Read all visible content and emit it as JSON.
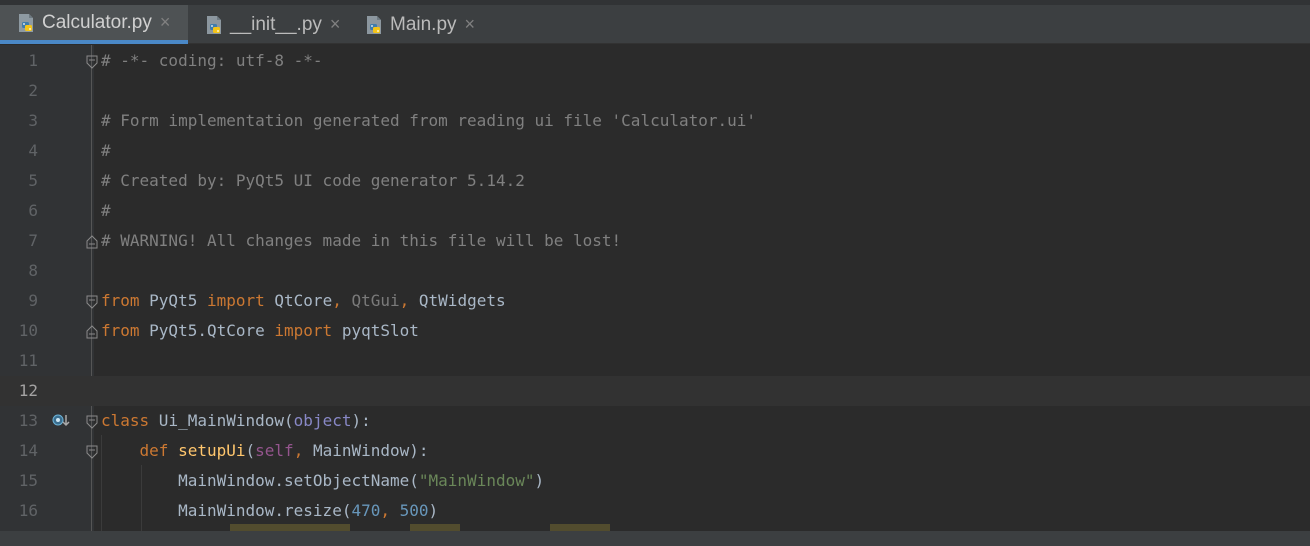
{
  "tabs": [
    {
      "label": "Calculator.py",
      "active": true
    },
    {
      "label": "__init__.py",
      "active": false
    },
    {
      "label": "Main.py",
      "active": false
    }
  ],
  "close_glyph": "×",
  "lines": [
    {
      "n": "1",
      "fold": "start",
      "tokens": [
        {
          "t": "# -*- coding: utf-8 -*-",
          "c": "comment"
        }
      ]
    },
    {
      "n": "2",
      "tokens": []
    },
    {
      "n": "3",
      "tokens": [
        {
          "t": "# Form implementation generated from reading ui file 'Calculator.ui'",
          "c": "comment"
        }
      ]
    },
    {
      "n": "4",
      "tokens": [
        {
          "t": "#",
          "c": "comment"
        }
      ]
    },
    {
      "n": "5",
      "tokens": [
        {
          "t": "# Created by: PyQt5 UI code generator 5.14.2",
          "c": "comment"
        }
      ]
    },
    {
      "n": "6",
      "tokens": [
        {
          "t": "#",
          "c": "comment"
        }
      ]
    },
    {
      "n": "7",
      "fold": "end",
      "tokens": [
        {
          "t": "# WARNING! All changes made in this file will be lost!",
          "c": "comment"
        }
      ]
    },
    {
      "n": "8",
      "tokens": []
    },
    {
      "n": "9",
      "fold": "start",
      "tokens": [
        {
          "t": "from",
          "c": "kw"
        },
        {
          "t": " PyQt5 ",
          "c": "plain"
        },
        {
          "t": "import",
          "c": "kw"
        },
        {
          "t": " QtCore",
          "c": "plain"
        },
        {
          "t": ", ",
          "c": "kw"
        },
        {
          "t": "QtGui",
          "c": "dim"
        },
        {
          "t": ", ",
          "c": "kw"
        },
        {
          "t": "QtWidgets",
          "c": "plain"
        }
      ]
    },
    {
      "n": "10",
      "fold": "end",
      "tokens": [
        {
          "t": "from",
          "c": "kw"
        },
        {
          "t": " PyQt5.QtCore ",
          "c": "plain"
        },
        {
          "t": "import",
          "c": "kw"
        },
        {
          "t": " pyqtSlot",
          "c": "plain"
        }
      ]
    },
    {
      "n": "11",
      "tokens": []
    },
    {
      "n": "12",
      "current": true,
      "tokens": []
    },
    {
      "n": "13",
      "fold": "start",
      "bookmark": true,
      "tokens": [
        {
          "t": "class",
          "c": "kw"
        },
        {
          "t": " Ui_MainWindow(",
          "c": "plain"
        },
        {
          "t": "object",
          "c": "builtin"
        },
        {
          "t": "):",
          "c": "plain"
        }
      ]
    },
    {
      "n": "14",
      "fold": "start",
      "tokens": [
        {
          "t": "    ",
          "c": "plain"
        },
        {
          "t": "def",
          "c": "kw"
        },
        {
          "t": " ",
          "c": "plain"
        },
        {
          "t": "setupUi",
          "c": "func"
        },
        {
          "t": "(",
          "c": "plain"
        },
        {
          "t": "self",
          "c": "self"
        },
        {
          "t": ", ",
          "c": "kw"
        },
        {
          "t": "MainWindow):",
          "c": "plain"
        }
      ]
    },
    {
      "n": "15",
      "tokens": [
        {
          "t": "        MainWindow.setObjectName(",
          "c": "plain"
        },
        {
          "t": "\"MainWindow\"",
          "c": "str"
        },
        {
          "t": ")",
          "c": "plain"
        }
      ]
    },
    {
      "n": "16",
      "tokens": [
        {
          "t": "        MainWindow.resize(",
          "c": "plain"
        },
        {
          "t": "470",
          "c": "num"
        },
        {
          "t": ", ",
          "c": "kw"
        },
        {
          "t": "500",
          "c": "num"
        },
        {
          "t": ")",
          "c": "plain"
        }
      ]
    }
  ]
}
